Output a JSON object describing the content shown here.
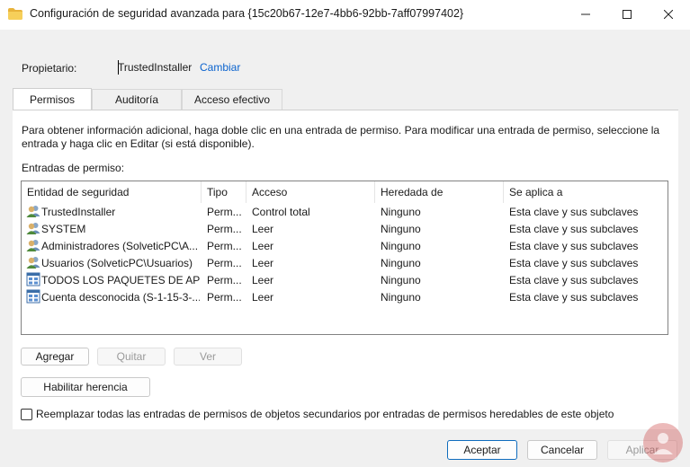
{
  "window": {
    "title": "Configuración de seguridad avanzada para {15c20b67-12e7-4bb6-92bb-7aff07997402}"
  },
  "owner": {
    "label": "Propietario:",
    "value": "TrustedInstaller",
    "change_link": "Cambiar"
  },
  "tabs": [
    {
      "label": "Permisos",
      "active": true
    },
    {
      "label": "Auditoría",
      "active": false
    },
    {
      "label": "Acceso efectivo",
      "active": false
    }
  ],
  "info_text": "Para obtener información adicional, haga doble clic en una entrada de permiso. Para modificar una entrada de permiso, seleccione la entrada y haga clic en Editar (si está disponible).",
  "entries_label": "Entradas de permiso:",
  "table": {
    "columns": [
      "Entidad de seguridad",
      "Tipo",
      "Acceso",
      "Heredada de",
      "Se aplica a"
    ],
    "rows": [
      {
        "icon": "user-group-icon",
        "cells": [
          "TrustedInstaller",
          "Perm...",
          "Control total",
          "Ninguno",
          "Esta clave y sus subclaves"
        ]
      },
      {
        "icon": "user-group-icon",
        "cells": [
          "SYSTEM",
          "Perm...",
          "Leer",
          "Ninguno",
          "Esta clave y sus subclaves"
        ]
      },
      {
        "icon": "user-group-icon",
        "cells": [
          "Administradores (SolveticPC\\A...",
          "Perm...",
          "Leer",
          "Ninguno",
          "Esta clave y sus subclaves"
        ]
      },
      {
        "icon": "user-group-icon",
        "cells": [
          "Usuarios (SolveticPC\\Usuarios)",
          "Perm...",
          "Leer",
          "Ninguno",
          "Esta clave y sus subclaves"
        ]
      },
      {
        "icon": "app-package-icon",
        "cells": [
          "TODOS LOS PAQUETES DE APLI...",
          "Perm...",
          "Leer",
          "Ninguno",
          "Esta clave y sus subclaves"
        ]
      },
      {
        "icon": "app-package-icon",
        "cells": [
          "Cuenta desconocida (S-1-15-3-...",
          "Perm...",
          "Leer",
          "Ninguno",
          "Esta clave y sus subclaves"
        ]
      }
    ]
  },
  "buttons": {
    "add": "Agregar",
    "remove": "Quitar",
    "view": "Ver",
    "enable_inheritance": "Habilitar herencia",
    "ok": "Aceptar",
    "cancel": "Cancelar",
    "apply": "Aplicar"
  },
  "replace_checkbox": {
    "label": "Reemplazar todas las entradas de permisos de objetos secundarios por entradas de permisos heredables de este objeto",
    "checked": false
  },
  "colors": {
    "link": "#0b63ce",
    "folder": "#f2c94c",
    "primary_border": "#0f6cbd"
  }
}
